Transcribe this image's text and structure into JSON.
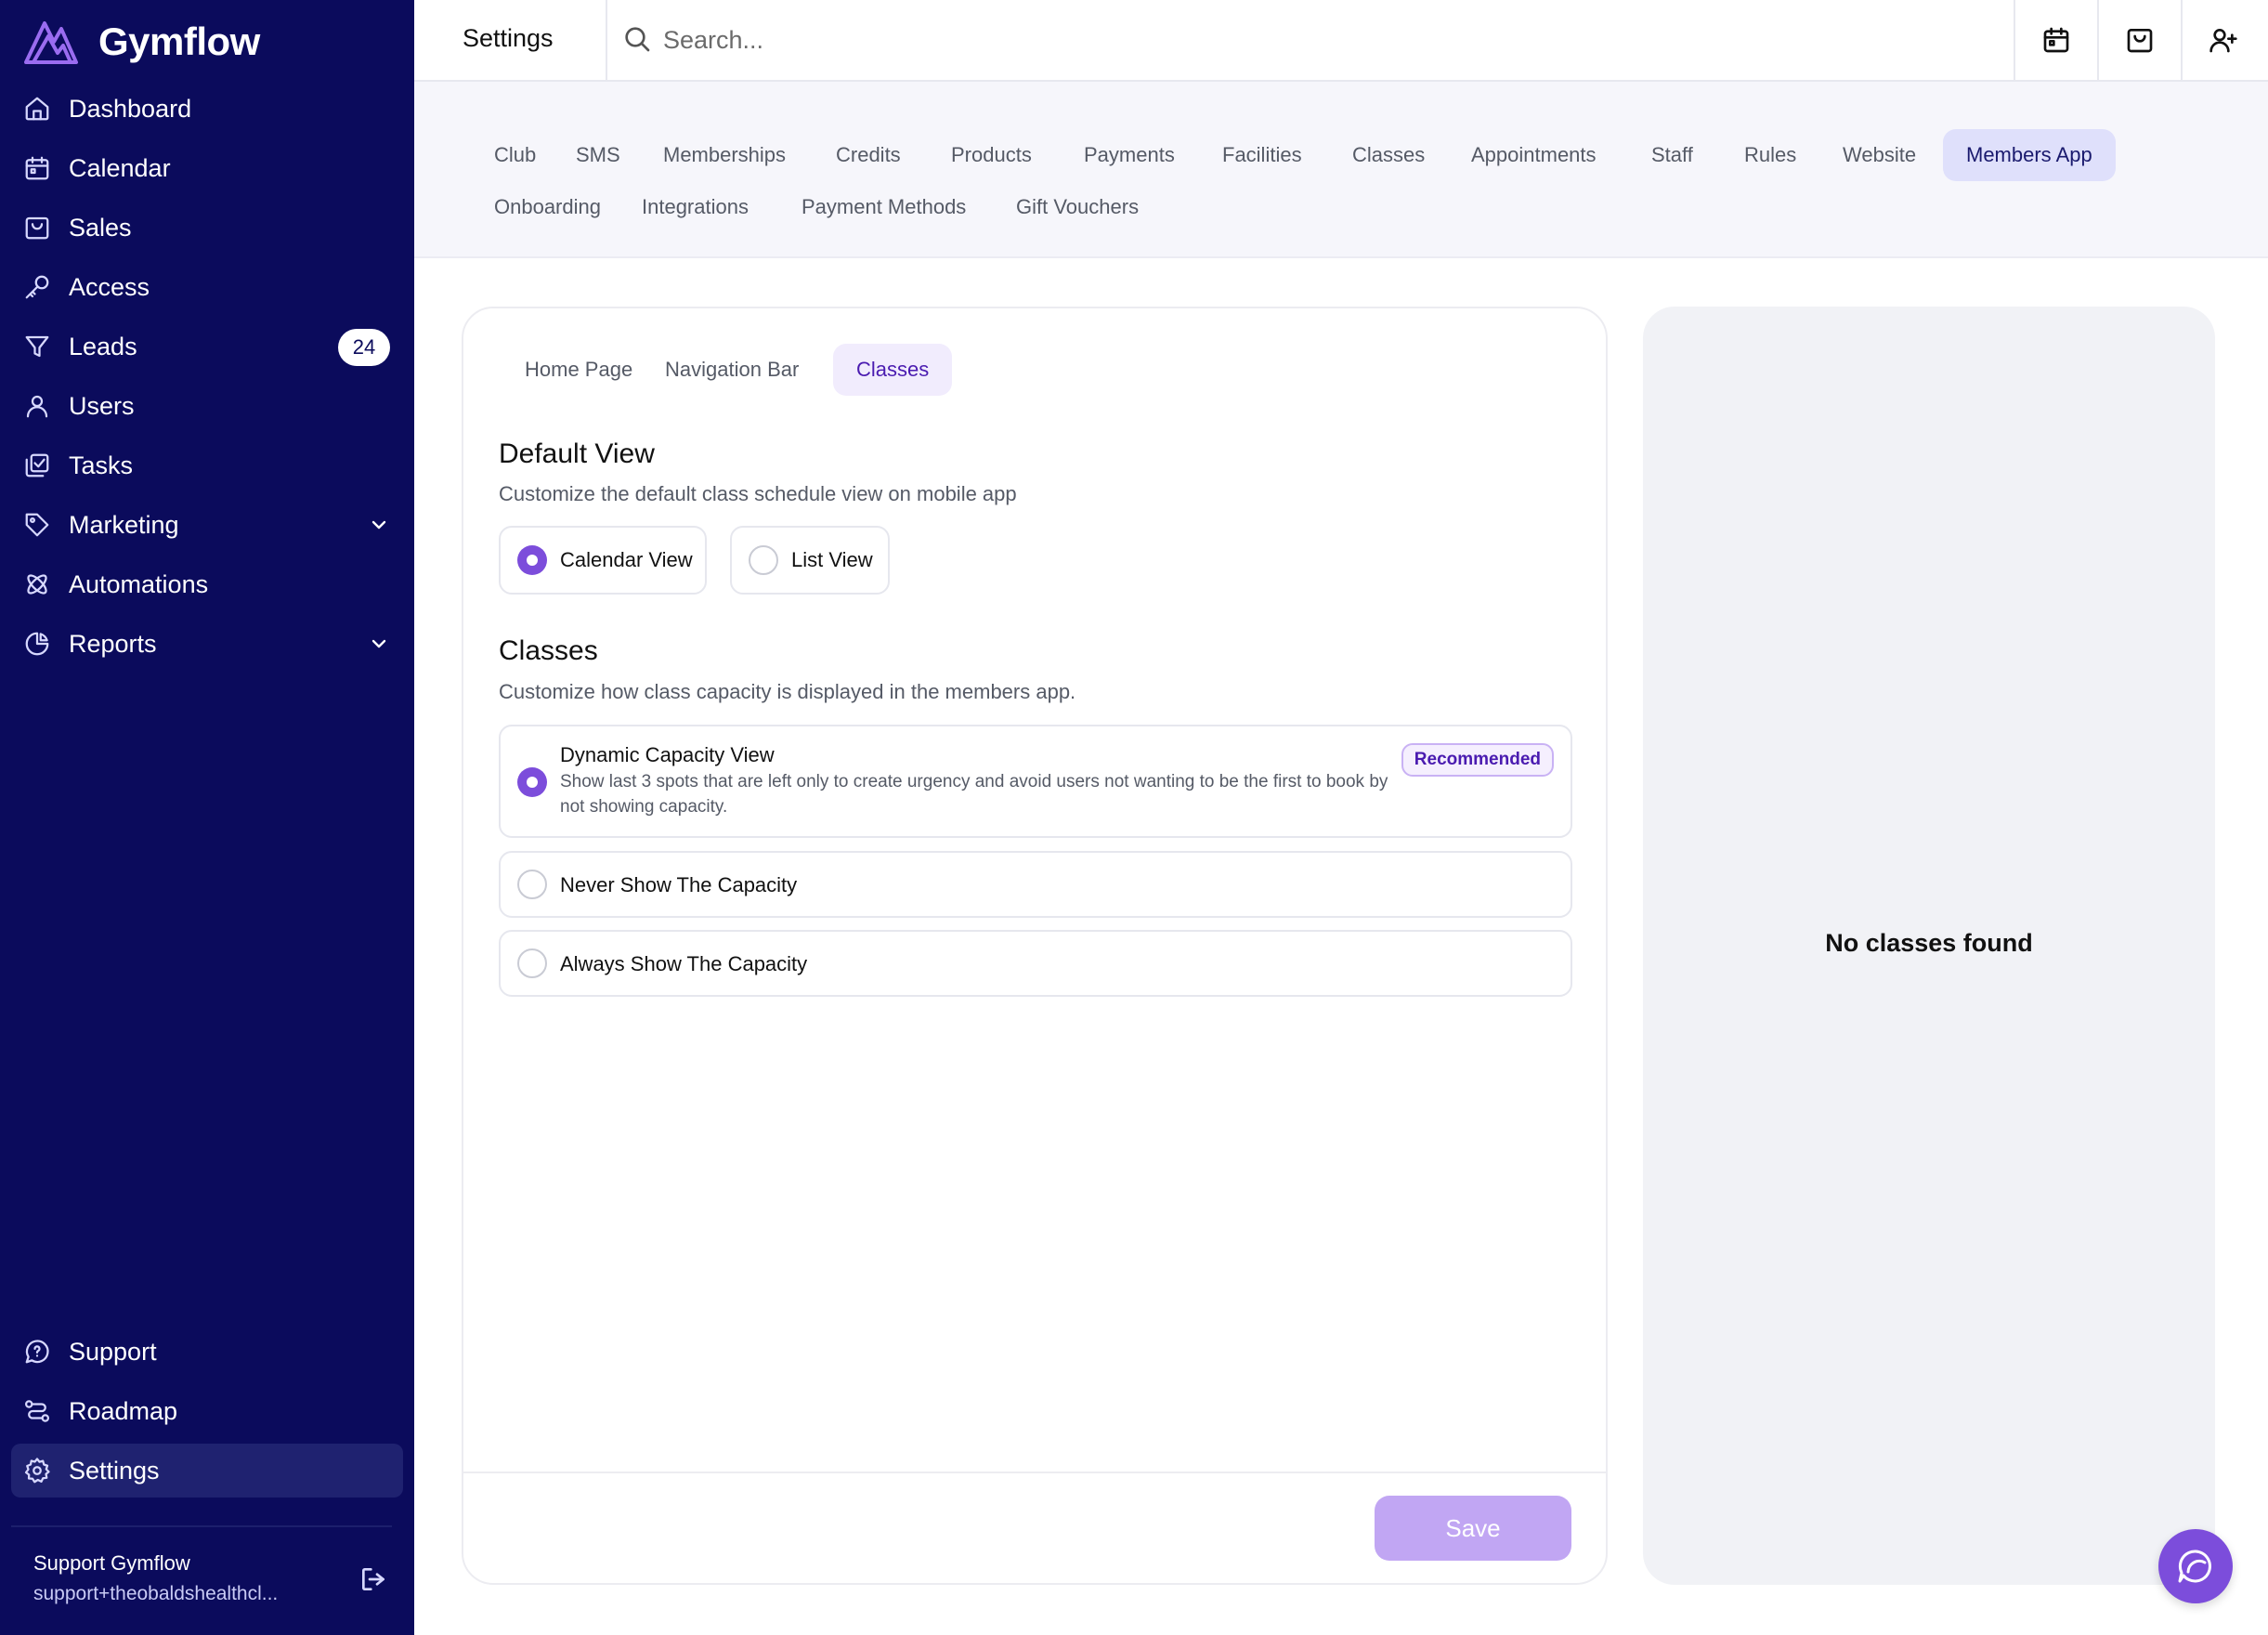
{
  "brand": {
    "name": "Gymflow",
    "accent": "#7c4ddb",
    "sidebar_bg": "#0b0b5c"
  },
  "sidebar": {
    "items": [
      {
        "label": "Dashboard",
        "icon": "home-icon"
      },
      {
        "label": "Calendar",
        "icon": "calendar-icon"
      },
      {
        "label": "Sales",
        "icon": "shopping-bag-icon"
      },
      {
        "label": "Access",
        "icon": "key-icon"
      },
      {
        "label": "Leads",
        "icon": "funnel-icon",
        "badge": "24"
      },
      {
        "label": "Users",
        "icon": "user-icon"
      },
      {
        "label": "Tasks",
        "icon": "tasks-icon"
      },
      {
        "label": "Marketing",
        "icon": "tag-icon",
        "expandable": true
      },
      {
        "label": "Automations",
        "icon": "automation-icon"
      },
      {
        "label": "Reports",
        "icon": "pie-chart-icon",
        "expandable": true
      }
    ],
    "bottom_items": [
      {
        "label": "Support",
        "icon": "support-chat-icon"
      },
      {
        "label": "Roadmap",
        "icon": "route-icon"
      },
      {
        "label": "Settings",
        "icon": "gear-icon",
        "active": true
      }
    ],
    "user": {
      "name": "Support Gymflow",
      "email": "support+theobaldshealthcl..."
    }
  },
  "topbar": {
    "title": "Settings",
    "search_placeholder": "Search...",
    "actions": [
      "calendar-icon",
      "shopping-bag-icon",
      "add-user-icon"
    ]
  },
  "settings_tabs": {
    "row1": [
      "Club",
      "SMS",
      "Memberships",
      "Credits",
      "Products",
      "Payments",
      "Facilities",
      "Classes",
      "Appointments",
      "Staff",
      "Rules",
      "Website",
      "Members App"
    ],
    "row2": [
      "Onboarding",
      "Integrations",
      "Payment Methods",
      "Gift Vouchers"
    ],
    "active": "Members App"
  },
  "subtabs": {
    "items": [
      "Home Page",
      "Navigation Bar",
      "Classes"
    ],
    "active": "Classes"
  },
  "default_view": {
    "title": "Default View",
    "description": "Customize the default class schedule view on mobile app",
    "options": [
      {
        "label": "Calendar View",
        "selected": true
      },
      {
        "label": "List View",
        "selected": false
      }
    ]
  },
  "classes": {
    "title": "Classes",
    "description": "Customize how class capacity is displayed in the members app.",
    "options": [
      {
        "label": "Dynamic Capacity View",
        "sub": "Show last 3 spots that are left only to create urgency and avoid users not wanting to be the first to book by not showing capacity.",
        "badge": "Recommended",
        "selected": true
      },
      {
        "label": "Never Show The Capacity",
        "selected": false
      },
      {
        "label": "Always Show The Capacity",
        "selected": false
      }
    ]
  },
  "save_label": "Save",
  "preview": {
    "empty_text": "No classes found"
  }
}
